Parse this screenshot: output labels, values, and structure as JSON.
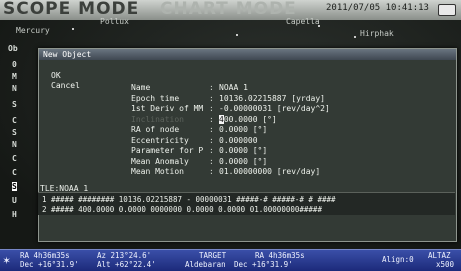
{
  "topbar": {
    "logo": "SCOPE MODE",
    "logo_faded": "CHART MODE",
    "datetime": "2011/07/05 10:41:13"
  },
  "sky_labels": [
    "Mercury",
    "Pollux",
    "Capella",
    "Hirphak"
  ],
  "side_chars": [
    "Ob",
    "0",
    "M",
    "N",
    "S",
    "C",
    "S",
    "N",
    "C",
    "C",
    "S",
    "U",
    "H"
  ],
  "dialog": {
    "title": "New Object",
    "list_items": [
      "OK",
      "Cancel"
    ],
    "fields": [
      {
        "label": "Name",
        "value": "NOAA 1"
      },
      {
        "label": "Epoch time",
        "value": "10136.02215887 [yrday]"
      },
      {
        "label": "1st Deriv of MM",
        "value": "-0.00000031 [rev/day^2]"
      },
      {
        "label": "Inclination",
        "value_cursor": "4",
        "value_rest": "00.0000 [°]"
      },
      {
        "label": "RA of node",
        "value": "0.0000 [°]"
      },
      {
        "label": "Eccentricity",
        "value": "0.000000"
      },
      {
        "label": "Parameter for P",
        "value": "0.0000 [°]"
      },
      {
        "label": "Mean Anomaly",
        "value": "0.0000 [°]"
      },
      {
        "label": "Mean Motion",
        "value": "01.00000000 [rev/day]"
      }
    ],
    "tle_label": "TLE:NOAA 1",
    "tle_line1": "1 ##### ######## 10136.02215887 - 00000031  #####-# #####-# # ####",
    "tle_line2": "2 ##### 400.0000 0.0000 0000000  0.0000  0.0000 01.00000000#####"
  },
  "status": {
    "ra": "RA   4h36m35s",
    "az": "Az 213°24.6'",
    "dec": "Dec +16°31.9'",
    "alt": "Alt +62°22.4'",
    "target_label": "TARGET",
    "target_name": "Aldebaran",
    "target_ra": "RA  4h36m35s",
    "target_dec": "Dec +16°31.9'",
    "align": "Align:0",
    "mode": "ALTAZ",
    "zoom": "x500"
  }
}
